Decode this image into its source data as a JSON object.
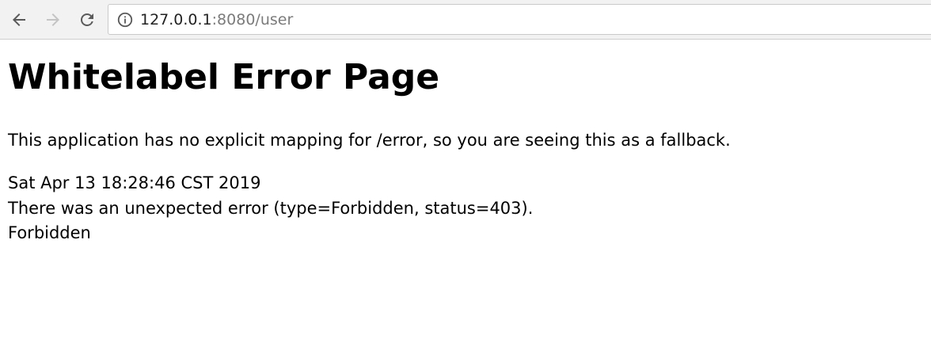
{
  "browser": {
    "back_icon": "arrow-left-icon",
    "forward_icon": "arrow-right-icon",
    "reload_icon": "reload-icon",
    "info_icon": "info-circle-icon",
    "url_host": "127.0.0.1",
    "url_rest": ":8080/user"
  },
  "page": {
    "title": "Whitelabel Error Page",
    "fallback_message": "This application has no explicit mapping for /error, so you are seeing this as a fallback.",
    "timestamp": "Sat Apr 13 18:28:46 CST 2019",
    "error_detail": "There was an unexpected error (type=Forbidden, status=403).",
    "error_message": "Forbidden"
  }
}
